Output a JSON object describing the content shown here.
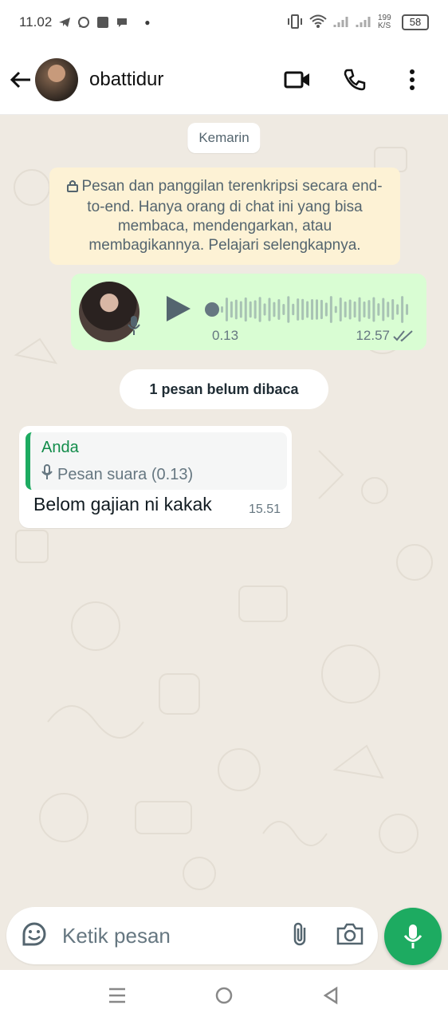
{
  "status_bar": {
    "time": "11.02",
    "net_speed": "199 K/S",
    "battery": "58",
    "icons": [
      "telegram-icon",
      "whatsapp-icon",
      "app-icon",
      "chat-icon",
      "dot-icon",
      "vibrate-icon",
      "wifi-icon",
      "signal-icon",
      "signal-icon"
    ]
  },
  "header": {
    "contact_name": "obattidur",
    "icons": {
      "back": "arrow-left-icon",
      "video": "video-call-icon",
      "voice": "phone-icon",
      "menu": "more-vert-icon"
    }
  },
  "chat": {
    "date_chip": "Kemarin",
    "encryption_notice": "Pesan dan panggilan terenkripsi secara end-to-end. Hanya orang di chat ini yang bisa membaca, mendengarkan, atau membagikannya. Pelajari selengkapnya.",
    "voice_message": {
      "elapsed": "0.13",
      "time": "12.57",
      "played_fraction": 0.0,
      "status": "read"
    },
    "unread_chip": "1 pesan belum dibaca",
    "incoming": {
      "quote_author": "Anda",
      "quote_text": "Pesan suara (0.13)",
      "text": "Belom gajian ni kakak",
      "time": "15.51"
    }
  },
  "composer": {
    "placeholder": "Ketik pesan",
    "icons": {
      "emoji": "sticker-icon",
      "attach": "paperclip-icon",
      "camera": "camera-icon",
      "mic": "mic-icon"
    }
  },
  "colors": {
    "accent": "#1dab61",
    "outgoing_bubble": "#d9fdd3",
    "chat_background": "#efeae2",
    "notice_background": "#fdf2d5"
  }
}
